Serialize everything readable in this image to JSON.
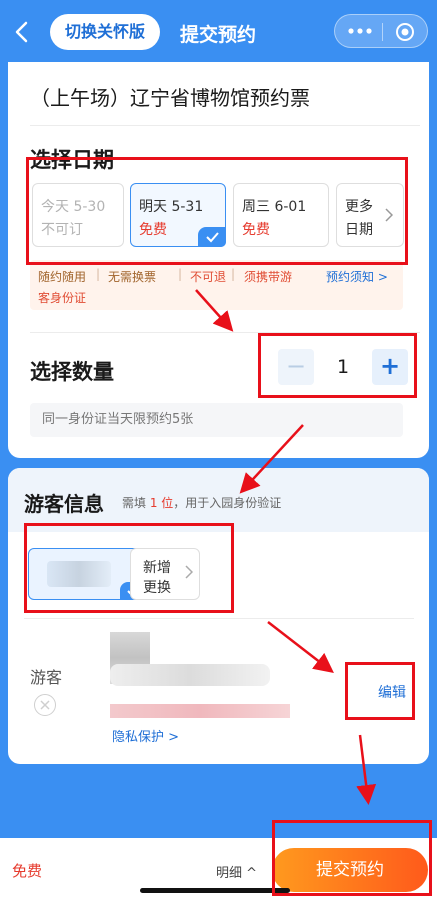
{
  "nav": {
    "care_mode": "切换关怀版",
    "title": "提交预约"
  },
  "ticket": {
    "title": "（上午场）辽宁省博物馆预约票"
  },
  "date_section": {
    "title": "选择日期",
    "options": [
      {
        "day": "今天 5-30",
        "status": "不可订"
      },
      {
        "day": "明天 5-31",
        "status": "免费"
      },
      {
        "day": "周三 6-01",
        "status": "免费"
      },
      {
        "day": "更多",
        "status": "日期"
      }
    ]
  },
  "notice": {
    "a": "随约随用",
    "b": "无需换票",
    "c": "不可退",
    "d": "须携带游",
    "e": "客身份证",
    "f": "预约须知 >",
    "sep": "|"
  },
  "quantity": {
    "title": "选择数量",
    "minus": "−",
    "value": "1",
    "plus": "+",
    "hint": "同一身份证当天限预约5张"
  },
  "visitor": {
    "title": "游客信息",
    "hint_prefix": "需填 ",
    "hint_count": "1 位",
    "hint_suffix": "，用于入园身份验证",
    "add_line1": "新增",
    "add_line2": "更换",
    "guest_label": "游客",
    "privacy": "隐私保护 >",
    "edit": "编辑"
  },
  "bottom": {
    "price": "免费",
    "detail": "明细 ^",
    "submit": "提交预约"
  },
  "colors": {
    "brand_blue": "#3a8ff2",
    "annotation_red": "#e8101a",
    "price_red": "#e63b2e",
    "submit_orange": "#ff6a1b"
  },
  "icons": [
    "back-arrow-icon",
    "more-dots-icon",
    "close-target-icon",
    "check-icon",
    "chevron-right-icon",
    "remove-circle-icon"
  ]
}
